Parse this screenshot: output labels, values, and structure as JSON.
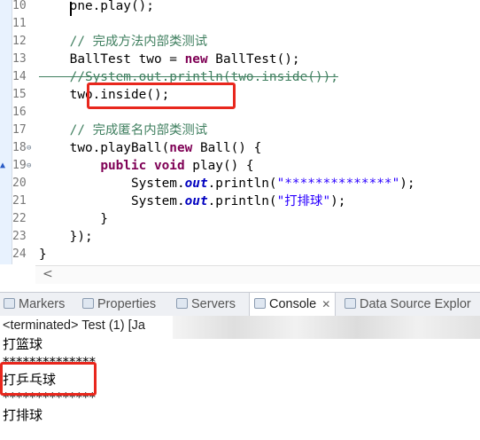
{
  "editor": {
    "lines": [
      {
        "n": "10",
        "tokens": [
          {
            "t": "    one.play();",
            "c": ""
          }
        ]
      },
      {
        "n": "11",
        "tokens": []
      },
      {
        "n": "12",
        "tokens": [
          {
            "t": "    // 完成方法内部类测试",
            "c": "cm"
          }
        ]
      },
      {
        "n": "13",
        "tokens": [
          {
            "t": "    BallTest two = ",
            "c": ""
          },
          {
            "t": "new",
            "c": "kw"
          },
          {
            "t": " BallTest();",
            "c": ""
          }
        ]
      },
      {
        "n": "14",
        "tokens": [
          {
            "t": "    //System.out.println(two.inside());",
            "c": "cm strike"
          }
        ]
      },
      {
        "n": "15",
        "tokens": [
          {
            "t": "    two.inside();",
            "c": ""
          }
        ]
      },
      {
        "n": "16",
        "tokens": []
      },
      {
        "n": "17",
        "tokens": [
          {
            "t": "    // 完成匿名内部类测试",
            "c": "cm"
          }
        ]
      },
      {
        "n": "18",
        "fold": "⊖",
        "tokens": [
          {
            "t": "    two.playBall(",
            "c": ""
          },
          {
            "t": "new",
            "c": "kw"
          },
          {
            "t": " Ball() {",
            "c": ""
          }
        ]
      },
      {
        "n": "19",
        "fold": "⊖",
        "foldup": "▲",
        "tokens": [
          {
            "t": "        ",
            "c": ""
          },
          {
            "t": "public void",
            "c": "kw"
          },
          {
            "t": " play() {",
            "c": ""
          }
        ]
      },
      {
        "n": "20",
        "tokens": [
          {
            "t": "            System.",
            "c": ""
          },
          {
            "t": "out",
            "c": "fld"
          },
          {
            "t": ".println(",
            "c": ""
          },
          {
            "t": "\"**************\"",
            "c": "str"
          },
          {
            "t": ");",
            "c": ""
          }
        ]
      },
      {
        "n": "21",
        "tokens": [
          {
            "t": "            System.",
            "c": ""
          },
          {
            "t": "out",
            "c": "fld"
          },
          {
            "t": ".println(",
            "c": ""
          },
          {
            "t": "\"打排球\"",
            "c": "str"
          },
          {
            "t": ");",
            "c": ""
          }
        ]
      },
      {
        "n": "22",
        "tokens": [
          {
            "t": "        }",
            "c": ""
          }
        ]
      },
      {
        "n": "23",
        "tokens": [
          {
            "t": "    });",
            "c": ""
          }
        ]
      },
      {
        "n": "24",
        "tokens": [
          {
            "t": "}",
            "c": ""
          }
        ]
      }
    ]
  },
  "panel": {
    "tabs": [
      {
        "label": "Markers",
        "icon": "markers-icon"
      },
      {
        "label": "Properties",
        "icon": "properties-icon"
      },
      {
        "label": "Servers",
        "icon": "servers-icon"
      },
      {
        "label": "Console",
        "icon": "console-icon",
        "active": true,
        "close": "✕"
      },
      {
        "label": "Data Source Explor",
        "icon": "data-source-icon"
      }
    ],
    "console_status": "<terminated> Test (1) [Ja",
    "output": [
      "打篮球",
      "**************",
      "打乒乓球",
      "**************",
      "打排球"
    ]
  },
  "colors": {
    "highlight_box": "#e8271d",
    "keyword": "#7f0055",
    "comment": "#3f7f5f",
    "string": "#2a00ff"
  }
}
